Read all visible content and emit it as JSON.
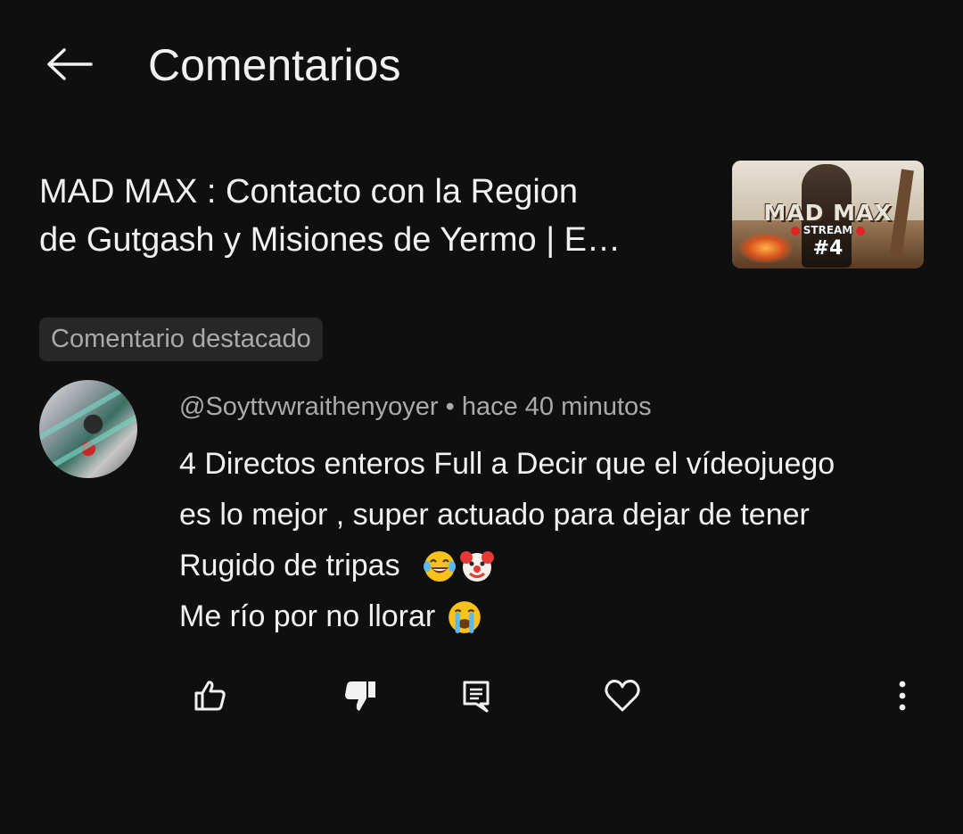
{
  "header": {
    "title": "Comentarios",
    "back_icon": "arrow-left-icon"
  },
  "video": {
    "title_line1": "MAD MAX : Contacto con la Region",
    "title_line2": "de Gutgash y Misiones de Yermo   | E…",
    "thumbnail": {
      "logo_text": "MAD MAX",
      "badge_text": "STREAM",
      "episode_text": "#4"
    }
  },
  "pinned_chip": {
    "label": "Comentario destacado"
  },
  "comment": {
    "author": "@Soyttvwraithenyoyer",
    "separator": "•",
    "time": "hace 40 minutos",
    "lines": [
      "4 Directos enteros Full a Decir que el vídeojuego",
      "es lo mejor , super actuado para dejar de tener",
      "Rugido de tripas",
      "Me río por no llorar"
    ],
    "emoji_line3": [
      "tears-of-joy-emoji",
      "clown-emoji"
    ],
    "emoji_line4": [
      "crying-emoji"
    ]
  },
  "actions": {
    "like_icon": "thumbs-up-icon",
    "dislike_icon": "thumbs-down-filled-icon",
    "reply_icon": "reply-comment-icon",
    "heart_icon": "heart-icon",
    "more_icon": "more-vertical-icon"
  },
  "colors": {
    "background": "#0f0f0f",
    "text_primary": "#f1f1f1",
    "text_secondary": "#aaaaaa",
    "chip_background": "#272727"
  }
}
